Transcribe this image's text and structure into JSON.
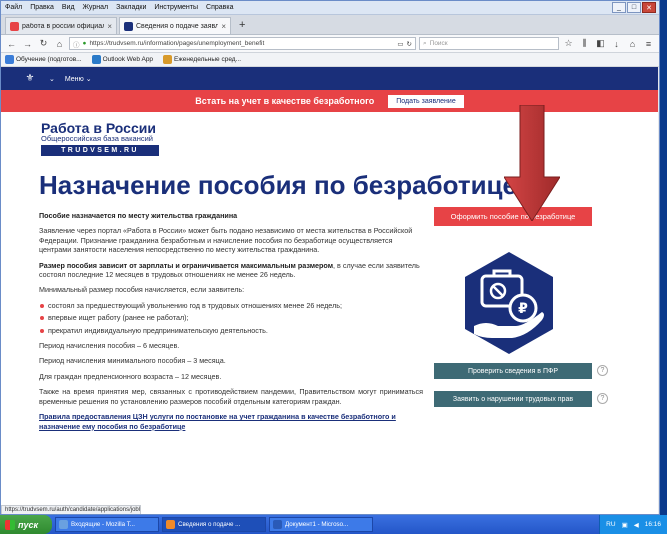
{
  "menu": [
    "Файл",
    "Правка",
    "Вид",
    "Журнал",
    "Закладки",
    "Инструменты",
    "Справка"
  ],
  "tabs": [
    {
      "title": "работа в россии официальн...",
      "favicon_color": "#e74346"
    },
    {
      "title": "Сведения о подаче заявлен...",
      "favicon_color": "#1a2f7a"
    }
  ],
  "url": "https://trudvsem.ru/information/pages/unemployment_benefit",
  "search_placeholder": "Поиск",
  "bookmarks": [
    "Обучение (подготов...",
    "Outlook Web App",
    "Еженедельные сред..."
  ],
  "site_nav": {
    "menu": "Меню"
  },
  "banner": {
    "text": "Встать на учет в качестве безработного",
    "button": "Подать заявление"
  },
  "logo": {
    "line1": "Работа в России",
    "line2": "Общероссийская база вакансий",
    "line3": "TRUDVSEM.RU"
  },
  "heading": "Назначение пособия по безработице",
  "content": {
    "p1": "Пособие назначается по месту жительства гражданина",
    "p2": "Заявление через портал «Работа в России» может быть подано независимо от места жительства в Российской Федерации. Признание гражданина безработным и начисление пособия по безработице осуществляется центрами занятости населения непосредственно по месту жительства гражданина.",
    "p3_bold": "Размер пособия зависит от зарплаты и ограничивается максимальным размером",
    "p3_rest": ", в случае если заявитель состоял последние 12 месяцев в трудовых отношениях не менее 26 недель.",
    "p4": "Минимальный размер пособия начисляется, если заявитель:",
    "bullets": [
      "состоял за предшествующий увольнению год в трудовых отношениях менее 26 недель;",
      "впервые ищет работу (ранее не работал);",
      "прекратил индивидуальную предпринимательскую деятельность."
    ],
    "p5": "Период начисления пособия – 6 месяцев.",
    "p6": "Период начисления минимального пособия – 3 месяца.",
    "p7": "Для граждан предпенсионного возраста – 12 месяцев.",
    "p8": "Также на время принятия мер, связанных с противодействием пандемии, Правительством могут приниматься временные решения по установлению размеров пособий отдельным категориям граждан.",
    "link": "Правила предоставления ЦЗН услуги по постановке на учет гражданина в качестве безработного и назначение ему пособия по безработице"
  },
  "sidebar": {
    "apply_button": "Оформить пособие по безработице",
    "pfr_button": "Проверить сведения в ПФР",
    "report_button": "Заявить о нарушении трудовых прав",
    "help": "?"
  },
  "status_url": "https://trudvsem.ru/auth/candidate/applications/jobless",
  "taskbar": {
    "start": "пуск",
    "tasks": [
      "Входящие - Mozilla T...",
      "Сведения о подаче ...",
      "Документ1 - Microso..."
    ],
    "lang": "RU",
    "time": "16:16"
  },
  "colors": {
    "brand": "#1a2f7a",
    "accent": "#e74346",
    "teal": "#3e6a75",
    "arrow": "#c43a3a"
  }
}
